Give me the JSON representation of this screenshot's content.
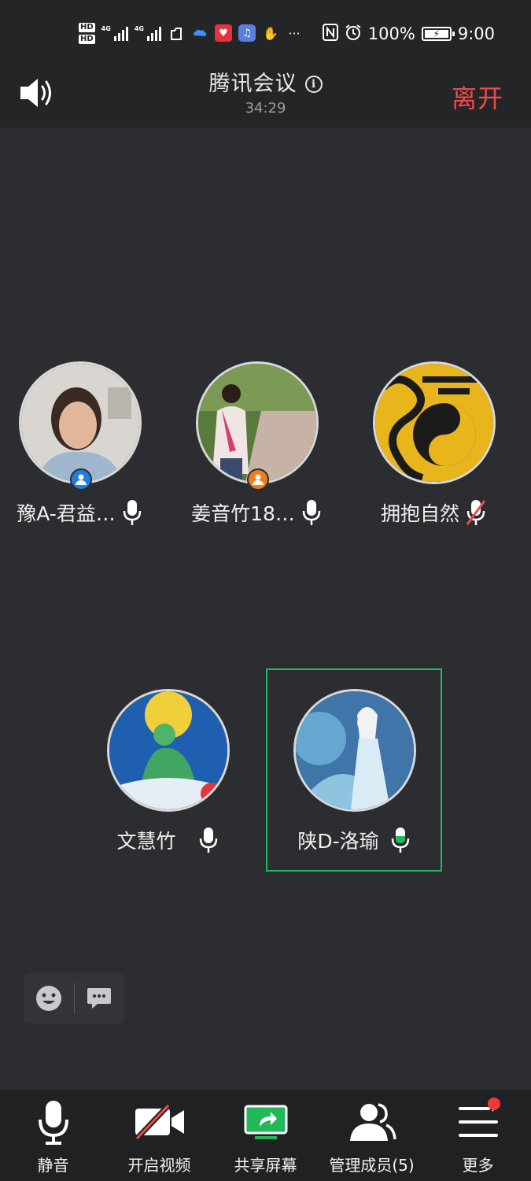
{
  "status_bar": {
    "hd1": "HD",
    "hd2": "HD",
    "net1": "4G",
    "net2": "4G",
    "battery": "100%",
    "time": "9:00",
    "more_dots": "···"
  },
  "header": {
    "title": "腾讯会议",
    "timer": "34:29",
    "leave_label": "离开"
  },
  "participants": [
    {
      "name": "豫A-君益…",
      "role": "host",
      "mic": "on",
      "avatar_color": "#c9c7c4"
    },
    {
      "name": "姜音竹18…",
      "role": "cohost",
      "mic": "on",
      "avatar_color": "#5a7a3a"
    },
    {
      "name": "拥抱自然",
      "role": "none",
      "mic": "muted",
      "avatar_color": "#e8b41a"
    },
    {
      "name": "文慧竹",
      "role": "none",
      "mic": "on",
      "avatar_color": "#1f5fb0"
    },
    {
      "name": "陕D-洛瑜",
      "role": "none",
      "mic": "speaking",
      "avatar_color": "#4f86b3"
    }
  ],
  "toolbar": {
    "mute_label": "静音",
    "video_label": "开启视频",
    "share_label": "共享屏幕",
    "members_label": "管理成员(5)",
    "more_label": "更多"
  },
  "colors": {
    "accent_green": "#21b85a",
    "leave_red": "#ef4a4c",
    "host_blue": "#1f7de6",
    "cohost_orange": "#ef7d1b"
  }
}
